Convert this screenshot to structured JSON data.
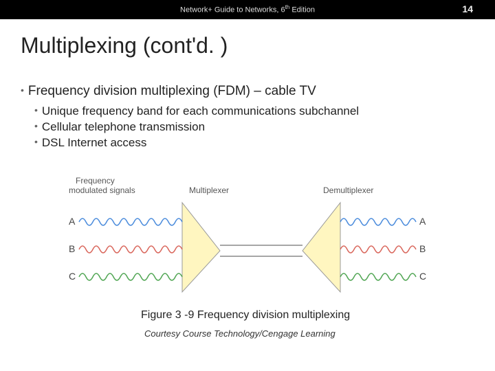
{
  "header": {
    "book_title_pre": "Network+ Guide to Networks, 6",
    "book_title_suffix": "th",
    "book_title_post": " Edition",
    "page_number": "14"
  },
  "title": "Multiplexing (cont'd. )",
  "bullets": {
    "l1": "Frequency division multiplexing (FDM) – cable TV",
    "l2a": "Unique frequency band for each communications subchannel",
    "l2b": "Cellular telephone transmission",
    "l2c": "DSL Internet access"
  },
  "figure": {
    "label_freq1": "Frequency",
    "label_freq2": "modulated signals",
    "label_mux": "Multiplexer",
    "label_demux": "Demultiplexer",
    "A": "A",
    "B": "B",
    "C": "C",
    "caption": "Figure 3 -9 Frequency division multiplexing",
    "courtesy": "Courtesy Course Technology/Cengage Learning"
  }
}
